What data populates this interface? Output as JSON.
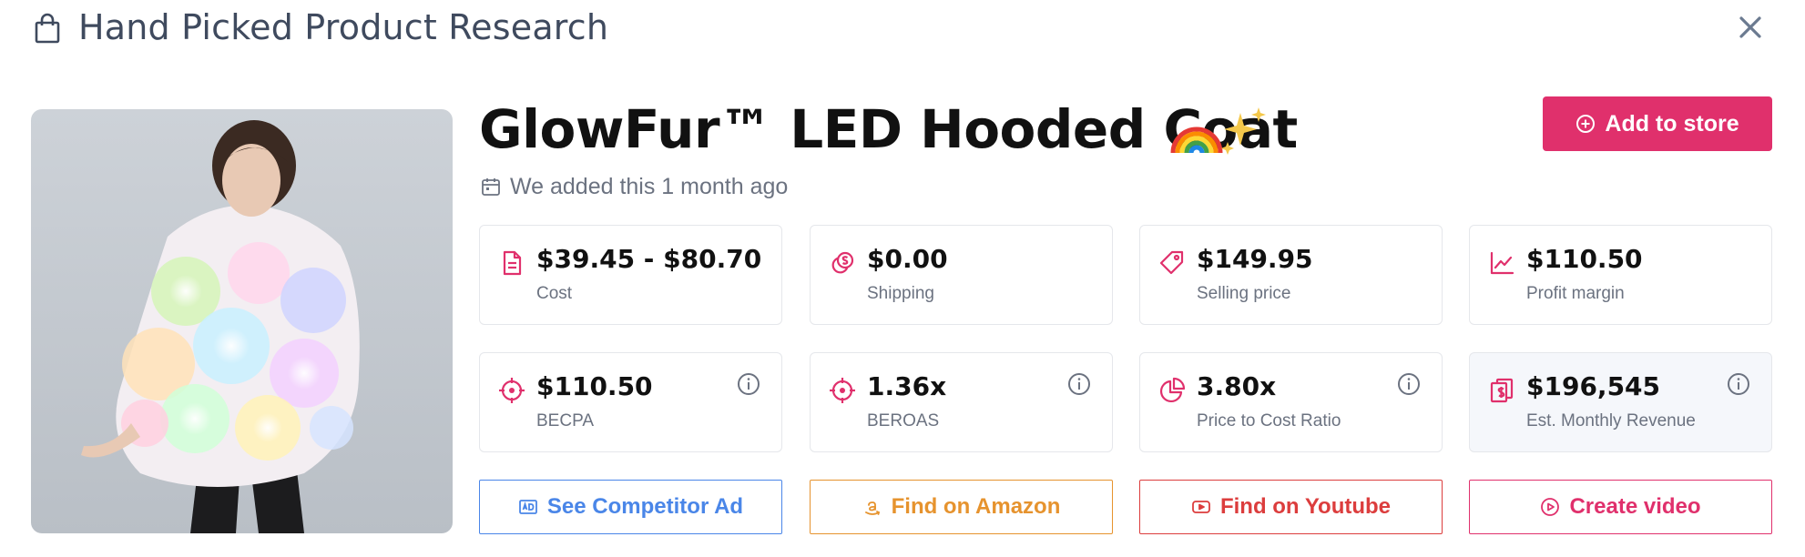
{
  "header": {
    "title": "Hand Picked Product Research",
    "icon": "shopping-bag-icon",
    "close_icon": "close-icon"
  },
  "product": {
    "title": "GlowFur™ LED Hooded Coat",
    "title_emoji": "🌈✨",
    "added_text": "We added this 1 month ago",
    "image_alt": "Woman wearing a multicolor LED fluffy faux fur hooded coat"
  },
  "actions": {
    "add_to_store": "Add to store",
    "see_competitor_ad": "See Competitor Ad",
    "find_on_amazon": "Find on Amazon",
    "find_on_youtube": "Find on Youtube",
    "create_video": "Create video"
  },
  "stats_row1": [
    {
      "value": "$39.45 - $80.70",
      "label": "Cost",
      "icon": "document-icon"
    },
    {
      "value": "$0.00",
      "label": "Shipping",
      "icon": "coins-icon"
    },
    {
      "value": "$149.95",
      "label": "Selling price",
      "icon": "price-tag-icon"
    },
    {
      "value": "$110.50",
      "label": "Profit margin",
      "icon": "trend-line-icon"
    }
  ],
  "stats_row2": [
    {
      "value": "$110.50",
      "label": "BECPA",
      "icon": "crosshair-icon"
    },
    {
      "value": "1.36x",
      "label": "BEROAS",
      "icon": "crosshair-icon"
    },
    {
      "value": "3.80x",
      "label": "Price to Cost Ratio",
      "icon": "pie-chart-icon"
    },
    {
      "value": "$196,545",
      "label": "Est. Monthly Revenue",
      "icon": "invoice-dollar-icon"
    }
  ],
  "colors": {
    "accent": "#e0306c",
    "icon_pink": "#e0306c",
    "competitor_blue": "#4a86e8",
    "amazon_orange": "#e6932e",
    "youtube_red": "#dc3d3d",
    "text_muted": "#6b7280"
  }
}
